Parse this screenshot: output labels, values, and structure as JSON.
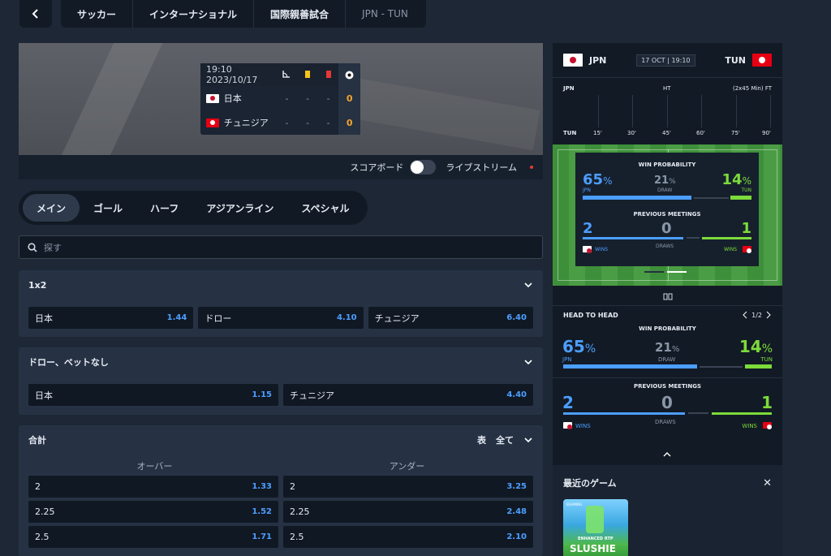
{
  "breadcrumb": [
    "サッカー",
    "インターナショナル",
    "国際親善試合",
    "JPN - TUN"
  ],
  "scoreboard": {
    "datetime": "19:10 2023/10/17",
    "rows": [
      {
        "team": "日本",
        "c1": "-",
        "c2": "-",
        "c3": "-",
        "goals": "0"
      },
      {
        "team": "チュニジア",
        "c1": "-",
        "c2": "-",
        "c3": "-",
        "goals": "0"
      }
    ]
  },
  "toggle": {
    "scoreboard_label": "スコアボード",
    "livestream_label": "ライブストリーム"
  },
  "tabs": [
    "メイン",
    "ゴール",
    "ハーフ",
    "アジアンライン",
    "スペシャル"
  ],
  "search": {
    "placeholder": "探す"
  },
  "markets": {
    "m1x2": {
      "title": "1x2",
      "odds": [
        {
          "label": "日本",
          "value": "1.44"
        },
        {
          "label": "ドロー",
          "value": "4.10"
        },
        {
          "label": "チュニジア",
          "value": "6.40"
        }
      ]
    },
    "dnb": {
      "title": "ドロー、ベットなし",
      "odds": [
        {
          "label": "日本",
          "value": "1.15"
        },
        {
          "label": "チュニジア",
          "value": "4.40"
        }
      ]
    },
    "total": {
      "title": "合計",
      "view_label": "表",
      "filter_label": "全て",
      "over_label": "オーバー",
      "under_label": "アンダー",
      "rows": [
        {
          "line": "2",
          "over": "1.33",
          "under": "3.25"
        },
        {
          "line": "2.25",
          "over": "1.52",
          "under": "2.48"
        },
        {
          "line": "2.5",
          "over": "1.71",
          "under": "2.10"
        }
      ]
    }
  },
  "right": {
    "home": "JPN",
    "away": "TUN",
    "date": "17 OCT | 19:10",
    "timeline": {
      "home": "JPN",
      "away": "TUN",
      "ht": "HT",
      "ft": "(2x45 Min) FT",
      "ticks": [
        "15'",
        "30'",
        "45'",
        "60'",
        "75'",
        "90'"
      ]
    },
    "card": {
      "win_prob": "WIN PROBABILITY",
      "home_pct": "65",
      "draw_pct": "21",
      "away_pct": "14",
      "pct_sign": "%",
      "home": "JPN",
      "draw": "DRAW",
      "away": "TUN",
      "prev": "PREVIOUS MEETINGS",
      "home_wins": "2",
      "draws": "0",
      "away_wins": "1",
      "wins": "WINS",
      "draws_label": "DRAWS"
    },
    "h2h": {
      "title": "HEAD TO HEAD",
      "page": "1/2"
    },
    "recent": {
      "title": "最近のゲーム",
      "game_label": "ENHANCED RTP",
      "game_name": "SLUSHIE",
      "provider": "BGAMING"
    },
    "colors": {
      "home": "#4c9eff",
      "away": "#7ddb3a",
      "draw": "#8a96a8"
    }
  }
}
